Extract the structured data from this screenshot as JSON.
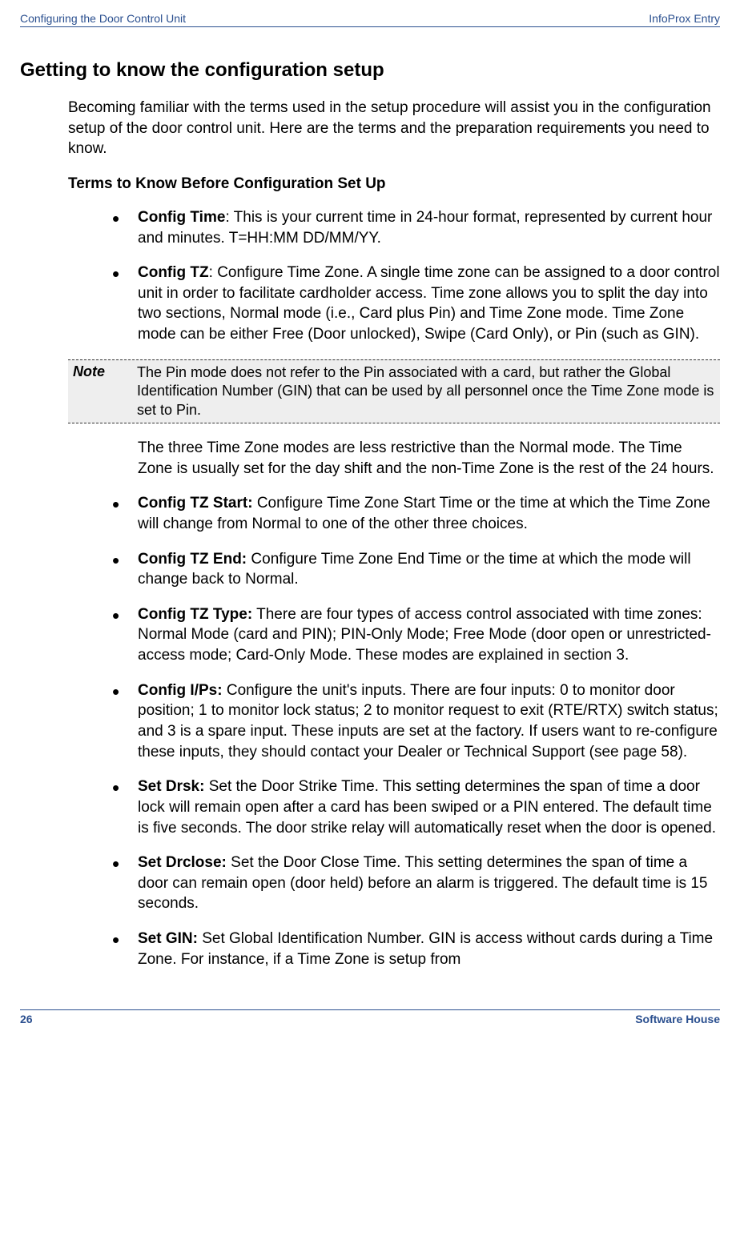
{
  "header": {
    "left": "Configuring the Door Control Unit",
    "right": "InfoProx Entry"
  },
  "main_heading": "Getting to know the configuration setup",
  "intro": "Becoming familiar with the terms used in the setup procedure will assist you in the configuration setup of the door control unit. Here are the terms and the preparation requirements you need to know.",
  "sub_heading": "Terms to Know Before Configuration Set Up",
  "terms": [
    {
      "label": "Config Time",
      "sep": ":  ",
      "text": "This is your current time in 24-hour format, represented by current hour and minutes. T=HH:MM  DD/MM/YY."
    },
    {
      "label": "Config TZ",
      "sep": ":  ",
      "text": "Configure Time Zone.  A single time zone can be assigned to a door control unit in order to facilitate cardholder access. Time zone allows you to split the day into two sections, Normal mode (i.e., Card plus Pin) and Time Zone mode. Time Zone mode can be either Free (Door unlocked), Swipe (Card Only), or Pin (such as GIN)."
    }
  ],
  "note": {
    "label": "Note",
    "text": "The Pin mode does not refer to the Pin associated with a card, but rather the Global Identification Number (GIN) that can be used by all personnel once the Time Zone mode is set to Pin."
  },
  "continued": "The three Time Zone modes are less restrictive than the Normal mode. The Time Zone is usually set for the day shift and the non-Time Zone is the rest of the 24 hours.",
  "terms2": [
    {
      "label": "Config TZ Start:",
      "sep": "  ",
      "text": "Configure Time Zone Start Time or the time at which the Time Zone will change from Normal to one of the other three choices."
    },
    {
      "label": "Config TZ End:",
      "sep": "  ",
      "text": "Configure Time Zone End Time or the time at which the mode will change back to Normal."
    },
    {
      "label": "Config TZ Type:",
      "sep": "  ",
      "text": "There are four types of access control associated with time zones: Normal Mode (card and PIN); PIN-Only Mode; Free Mode (door open or unrestricted-access mode; Card-Only Mode. These modes are explained in section 3."
    },
    {
      "label": "Config I/Ps:",
      "sep": "  ",
      "text": "Configure the unit's inputs. There are four inputs: 0 to monitor door position; 1 to monitor lock status; 2 to monitor request to exit (RTE/RTX) switch status; and 3 is a spare input.  These inputs are set at the factory. If users want to re-configure these inputs, they should contact your Dealer or Technical Support (see page 58)."
    },
    {
      "label": "Set Drsk:",
      "sep": "  ",
      "text": "Set the Door Strike Time. This setting determines the span of time a door lock will remain open after a card has been swiped or a PIN entered.  The default time is five seconds. The door strike relay will automatically reset when the door is opened."
    },
    {
      "label": "Set Drclose:",
      "sep": "  ",
      "text": "Set the Door Close Time. This setting determines the span of time a door can remain open (door held) before an alarm is triggered. The default time is 15 seconds."
    },
    {
      "label": "Set GIN:",
      "sep": "  ",
      "text": "Set Global Identification Number. GIN is access without cards during a Time Zone. For instance, if a Time Zone is setup from"
    }
  ],
  "footer": {
    "left": "26",
    "right": "Software House"
  }
}
